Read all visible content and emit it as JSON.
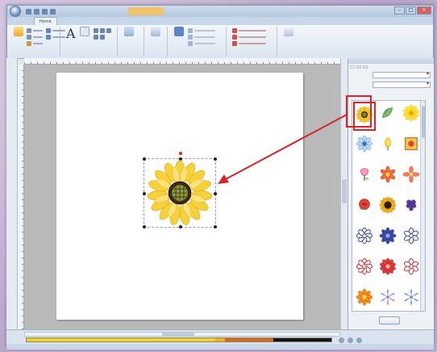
{
  "window": {
    "title": "",
    "title_tab": "",
    "controls": [
      "–",
      "□",
      "✕"
    ]
  },
  "ribbon": {
    "tabs": [
      "",
      "Home",
      "",
      "",
      ""
    ],
    "groups": [
      "",
      "",
      "",
      "",
      "",
      "",
      ""
    ]
  },
  "canvas": {
    "page_caption": "",
    "selected_design": "sunflower",
    "annotation_color": "#d6262a"
  },
  "panel": {
    "header": "",
    "tabs": [
      "",
      "",
      ""
    ],
    "fields": [
      {
        "label": "",
        "value": ""
      },
      {
        "label": "",
        "value": ""
      }
    ],
    "button_label": "",
    "grid": [
      {
        "caption": "",
        "icon": "sunflower-icon"
      },
      {
        "caption": "",
        "icon": "leaf-icon"
      },
      {
        "caption": "",
        "icon": "yellow-flower-icon"
      },
      {
        "caption": "",
        "icon": "blue-flower-icon"
      },
      {
        "caption": "",
        "icon": "yellow-bud-icon"
      },
      {
        "caption": "",
        "icon": "square-flower-icon"
      },
      {
        "caption": "",
        "icon": "pink-tulip-icon"
      },
      {
        "caption": "",
        "icon": "red-flower-icon"
      },
      {
        "caption": "",
        "icon": "red-cross-flower-icon"
      },
      {
        "caption": "",
        "icon": "rose-icon"
      },
      {
        "caption": "",
        "icon": "sunflower-small-icon"
      },
      {
        "caption": "",
        "icon": "grape-icon"
      },
      {
        "caption": "",
        "icon": "blue-outline-flower-icon"
      },
      {
        "caption": "",
        "icon": "blue-filled-flower-icon"
      },
      {
        "caption": "",
        "icon": "blue-outline-flower-2-icon"
      },
      {
        "caption": "",
        "icon": "red-outline-flower-icon"
      },
      {
        "caption": "",
        "icon": "red-filled-flower-icon"
      },
      {
        "caption": "",
        "icon": "red-outline-flower-2-icon"
      },
      {
        "caption": "",
        "icon": "orange-flower-icon"
      },
      {
        "caption": "",
        "icon": "purple-star-flower-icon"
      },
      {
        "caption": "",
        "icon": "blue-star-flower-icon"
      }
    ]
  },
  "status": {
    "zoom": "",
    "text": ""
  },
  "thread_colors": [
    "#f2d21c",
    "#f4b314",
    "#d96a10",
    "#141414"
  ]
}
